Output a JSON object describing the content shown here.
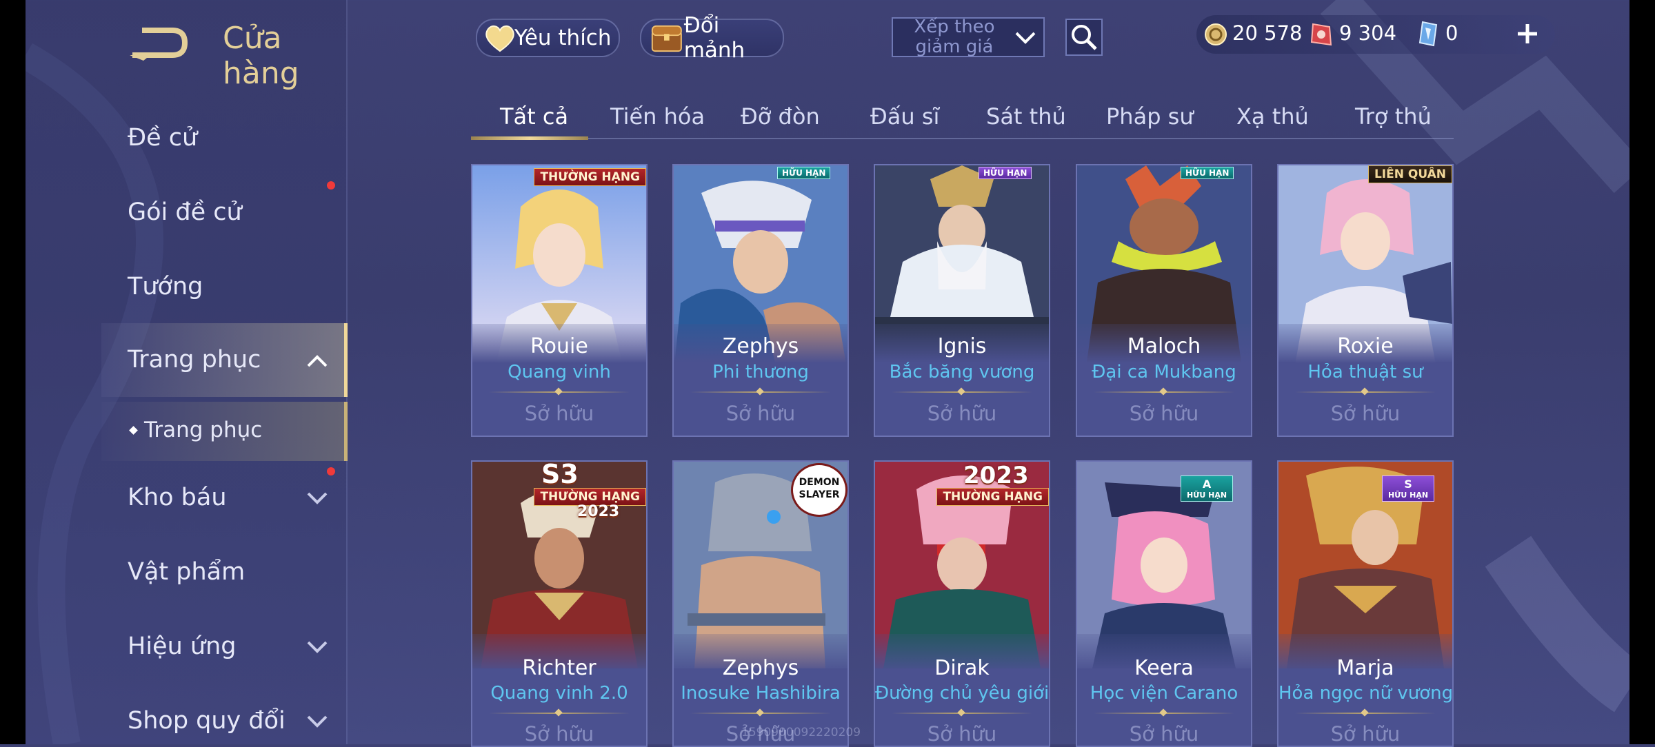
{
  "header": {
    "title": "Cửa hàng",
    "favorites_label": "Yêu thích",
    "exchange_label": "Đổi mảnh",
    "sort_label": "Xếp theo giảm giá",
    "currency": [
      {
        "icon": "gold-coin-icon",
        "value": "20 578"
      },
      {
        "icon": "red-voucher-icon",
        "value": "9 304"
      },
      {
        "icon": "blue-crystal-icon",
        "value": "0"
      }
    ]
  },
  "sidebar": {
    "items": [
      {
        "label": "Đề cử"
      },
      {
        "label": "Gói đề cử"
      },
      {
        "label": "Tướng"
      },
      {
        "label": "Trang phục"
      },
      {
        "label": "Trang phục"
      },
      {
        "label": "Kho báu"
      },
      {
        "label": "Vật phẩm"
      },
      {
        "label": "Hiệu ứng"
      },
      {
        "label": "Shop quy đổi"
      }
    ]
  },
  "tabs": [
    "Tất cả",
    "Tiến hóa",
    "Đỡ đòn",
    "Đấu sĩ",
    "Sát thủ",
    "Pháp sư",
    "Xạ thủ",
    "Trợ thủ"
  ],
  "cards": [
    {
      "hero": "Rouie",
      "skin": "Quang vinh",
      "status": "Sở hữu",
      "badge": "THƯỜNG HẠNG"
    },
    {
      "hero": "Zephys",
      "skin": "Phi thương",
      "status": "Sở hữu",
      "badge": "HỮU HẠN"
    },
    {
      "hero": "Ignis",
      "skin": "Bắc băng vương",
      "status": "Sở hữu",
      "badge": "HỮU HẠN"
    },
    {
      "hero": "Maloch",
      "skin": "Đại ca Mukbang",
      "status": "Sở hữu",
      "badge": "HỮU HẠN"
    },
    {
      "hero": "Roxie",
      "skin": "Hỏa thuật sư",
      "status": "Sở hữu",
      "badge": "LIÊN QUÂN"
    },
    {
      "hero": "Richter",
      "skin": "Quang vinh 2.0",
      "status": "Sở hữu",
      "badge": "THƯỜNG HẠNG",
      "season": "S3",
      "year": "2023"
    },
    {
      "hero": "Zephys",
      "skin": "Inosuke Hashibira",
      "status": "Sở hữu",
      "badge": "DEMON SLAYER"
    },
    {
      "hero": "Dirak",
      "skin": "Đường chủ yêu giới",
      "status": "Sở hữu",
      "badge": "THƯỜNG HẠNG",
      "year": "2023"
    },
    {
      "hero": "Keera",
      "skin": "Học viện Carano",
      "status": "Sở hữu",
      "badge": "HỮU HẠN",
      "tier": "A"
    },
    {
      "hero": "Marja",
      "skin": "Hỏa ngọc nữ vương",
      "status": "Sở hữu",
      "badge": "HỮU HẠN",
      "tier": "S"
    }
  ],
  "watermark": "1590900092220209",
  "colors": {
    "accent_gold": "#e3cf98",
    "skin_blue": "#5fc6f0",
    "notification_red": "#f03a3a"
  }
}
